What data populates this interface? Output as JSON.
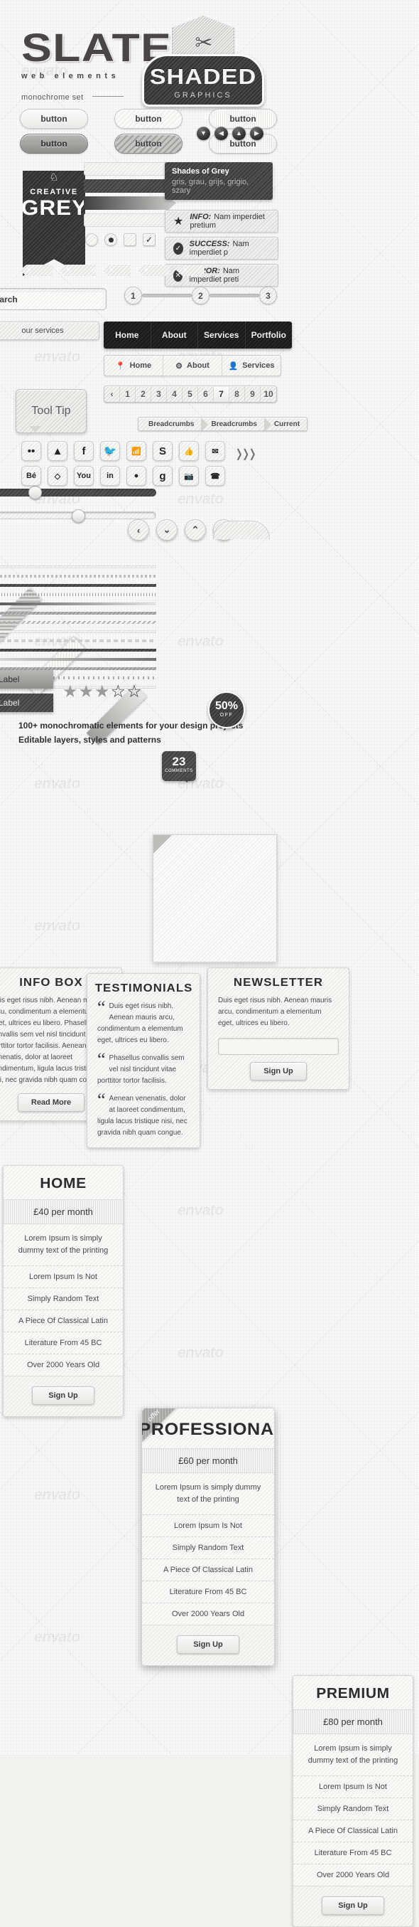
{
  "header": {
    "logo": "SLATE",
    "tagline": "web elements",
    "subtitle": "monochrome set",
    "badge": {
      "icon": "tools-icon",
      "title": "SHADED",
      "subtitle": "GRAPHICS"
    }
  },
  "buttons": {
    "row1": [
      "button",
      "button",
      "button"
    ],
    "row2": [
      "button",
      "button",
      "button"
    ],
    "arrows": [
      "▼",
      "◀",
      "▲",
      "▶"
    ]
  },
  "ribbon": {
    "icon": "badge-icon",
    "line1": "CREATIVE",
    "line2": "GREY"
  },
  "shades": {
    "title": "Shades of Grey",
    "subtitle": "gris, grau, grijs, grigio, szary"
  },
  "alerts": [
    {
      "icon": "star-icon",
      "label": "INFO:",
      "text": "Nam imperdiet pretium"
    },
    {
      "icon": "check-icon",
      "label": "SUCCESS:",
      "text": "Nam imperdiet p"
    },
    {
      "icon": "close-icon",
      "label": "ERROR:",
      "text": "Nam imperdiet preti"
    }
  ],
  "search": {
    "value": "search",
    "placeholder": "search",
    "icon": "search-icon"
  },
  "steps": [
    "1",
    "2",
    "3"
  ],
  "services_button": "our services",
  "nav_dark": [
    "Home",
    "About",
    "Services",
    "Portfolio"
  ],
  "nav_light": [
    {
      "icon": "pin-icon",
      "label": "Home"
    },
    {
      "icon": "gear-icon",
      "label": "About"
    },
    {
      "icon": "user-icon",
      "label": "Services"
    }
  ],
  "tooltip": "Tool Tip",
  "pagination": {
    "prev": "‹",
    "pages": [
      "1",
      "2",
      "3",
      "4",
      "5",
      "6",
      "7",
      "8",
      "9",
      "10"
    ],
    "active": "7"
  },
  "breadcrumbs": [
    "Breadcrumbs",
    "Breadcrumbs",
    "Current"
  ],
  "social_row1": [
    "flickr-icon",
    "delicious-icon",
    "facebook-icon",
    "twitter-icon",
    "rss-icon",
    "skype-icon",
    "thumbs-up-icon",
    "mail-icon"
  ],
  "social_row2": [
    "behance-icon",
    "dropbox-icon",
    "youtube-icon",
    "linkedin-icon",
    "dribbble-icon",
    "google-icon",
    "instagram-icon",
    "phone-icon"
  ],
  "round_arrows": [
    "‹",
    "⌄",
    "⌃",
    "›"
  ],
  "comments": {
    "count": "23",
    "label": "COMMENTS"
  },
  "labels": [
    "Label",
    "Label"
  ],
  "stars": {
    "filled": 3,
    "total": 5
  },
  "promo": {
    "line1": "100+ monochromatic elements for your design projects",
    "line2": "Editable layers, styles and patterns"
  },
  "seal": {
    "percent": "50%",
    "off": "OFF"
  },
  "pricing": [
    {
      "name": "HOME",
      "price": "£40 per month",
      "desc": "Lorem Ipsum is simply dummy text of the printing",
      "features": [
        "Lorem Ipsum Is Not",
        "Simply Random Text",
        "A Piece Of Classical Latin",
        "Literature From 45 BC",
        "Over 2000 Years Old"
      ],
      "cta": "Sign Up",
      "featured": false,
      "offer": ""
    },
    {
      "name": "PROFESSIONAL",
      "price": "£60 per month",
      "desc": "Lorem Ipsum is simply dummy text of the printing",
      "features": [
        "Lorem Ipsum Is Not",
        "Simply Random Text",
        "A Piece Of Classical Latin",
        "Literature From 45 BC",
        "Over 2000 Years Old"
      ],
      "cta": "Sign Up",
      "featured": true,
      "offer": "offer"
    },
    {
      "name": "PREMIUM",
      "price": "£80 per month",
      "desc": "Lorem Ipsum is simply dummy text of the printing",
      "features": [
        "Lorem Ipsum Is Not",
        "Simply Random Text",
        "A Piece Of Classical Latin",
        "Literature From 45 BC",
        "Over 2000 Years Old"
      ],
      "cta": "Sign Up",
      "featured": false,
      "offer": ""
    }
  ],
  "infobox": {
    "title": "INFO BOX",
    "text": "Duis eget risus nibh. Aenean mauris arcu, condimentum a elementum eget, ultrices eu libero. Phasellus convallis sem vel nisl tincidunt vitae porttitor tortor facilisis. Aenean venenatis, dolor at laoreet condimentum, ligula lacus tristique nisi, nec gravida nibh quam congue.",
    "button": "Read More"
  },
  "testimonials": {
    "title": "TESTIMONIALS",
    "items": [
      "Duis eget risus nibh. Aenean mauris arcu, condimentum a elementum eget, ultrices eu libero.",
      "Phasellus convallis sem vel nisl tincidunt vitae porttitor tortor facilisis.",
      "Aenean venenatis, dolor at laoreet condimentum, ligula lacus tristique nisi, nec gravida nibh quam congue."
    ]
  },
  "newsletter": {
    "title": "NEWSLETTER",
    "text": "Duis eget risus nibh. Aenean mauris arcu, condimentum a elementum eget, ultrices eu libero.",
    "button": "Sign Up"
  },
  "watermark": "envato",
  "colors": {
    "dark": "#363636",
    "mid": "#9b9b9b",
    "light": "#ececea",
    "page_bg": "#f1f1ef"
  }
}
